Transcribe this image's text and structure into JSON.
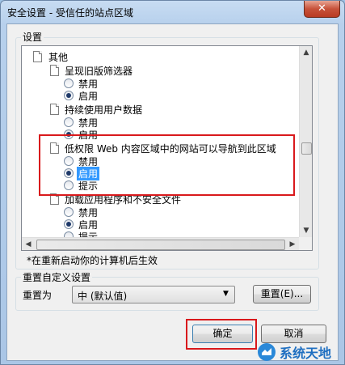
{
  "window": {
    "title": "安全设置 - 受信任的站点区域",
    "close_glyph": "✕"
  },
  "settings": {
    "group_label": "设置",
    "items": [
      {
        "label": "其他"
      },
      {
        "label": "呈现旧版筛选器",
        "options": [
          {
            "label": "禁用",
            "checked": false
          },
          {
            "label": "启用",
            "checked": true
          }
        ]
      },
      {
        "label": "持续使用用户数据",
        "options": [
          {
            "label": "禁用",
            "checked": false
          },
          {
            "label": "启用",
            "checked": true
          }
        ]
      },
      {
        "label": "低权限 Web 内容区域中的网站可以导航到此区域",
        "options": [
          {
            "label": "禁用",
            "checked": false
          },
          {
            "label": "启用",
            "checked": true
          },
          {
            "label": "提示",
            "checked": false
          }
        ]
      },
      {
        "label": "加载应用程序和不安全文件",
        "options": [
          {
            "label": "禁用",
            "checked": false
          },
          {
            "label": "启用",
            "checked": true
          },
          {
            "label": "提示",
            "checked": false
          }
        ]
      }
    ],
    "restart_note": "*在重新启动你的计算机后生效"
  },
  "reset": {
    "group_label": "重置自定义设置",
    "reset_to_label": "重置为",
    "selected_value": "中 (默认值)",
    "reset_button": "重置(E)..."
  },
  "buttons": {
    "ok": "确定",
    "cancel": "取消"
  },
  "watermark": {
    "text": "系统天地"
  },
  "colors": {
    "highlight": "#d9191c",
    "selection": "#3399ff"
  }
}
